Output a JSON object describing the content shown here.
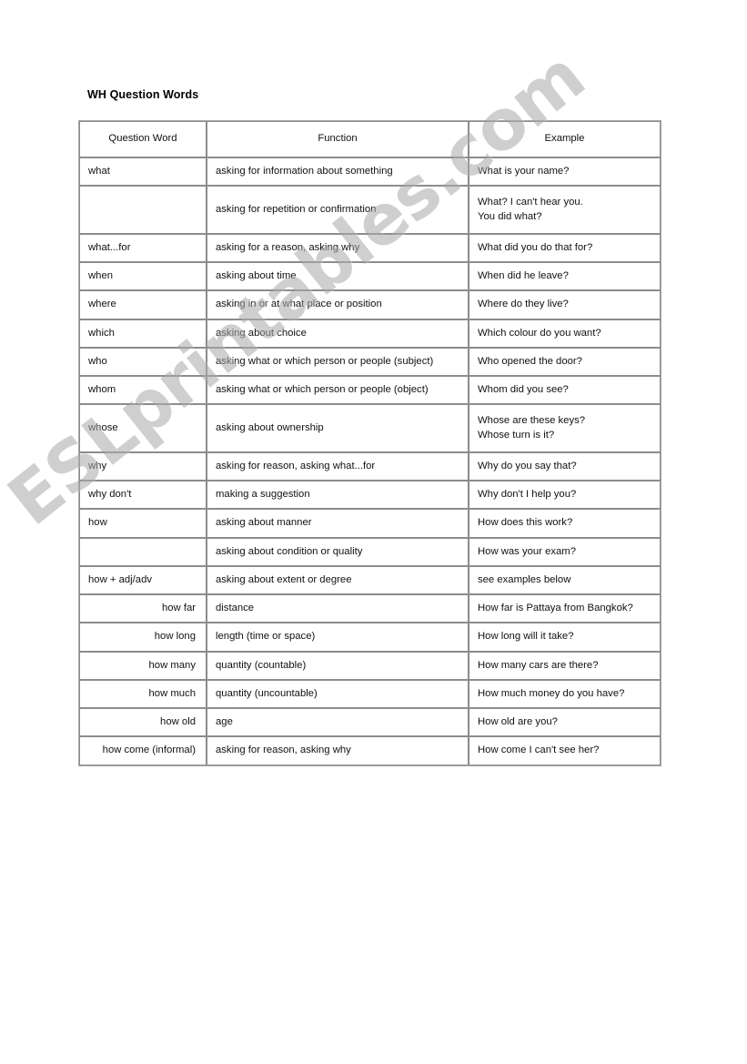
{
  "document": {
    "title": "WH Question Words",
    "watermark": "ESLprintables.com",
    "accent_blue": "#2b2b9e",
    "text_color": "#111111",
    "background": "#ffffff",
    "border_color": "#8c8c8c"
  },
  "table": {
    "headers": {
      "col1": "Question Word",
      "col2": "Function",
      "col3": "Example"
    },
    "rows": [
      {
        "word": "what",
        "indent": false,
        "function": "asking for information about something",
        "example": [
          "What is your name?"
        ]
      },
      {
        "word": "",
        "indent": false,
        "function": "asking for repetition or confirmation",
        "example": [
          "What? I can't hear you.",
          "You did what?"
        ]
      },
      {
        "word": "what...for",
        "indent": false,
        "function": "asking for a reason, asking why",
        "example": [
          "What did you do that for?"
        ]
      },
      {
        "word": "when",
        "indent": false,
        "function": "asking about time",
        "example": [
          "When did he leave?"
        ]
      },
      {
        "word": "where",
        "indent": false,
        "function": "asking in or at what place or position",
        "example": [
          "Where do they live?"
        ]
      },
      {
        "word": "which",
        "indent": false,
        "function": "asking about choice",
        "example": [
          "Which colour do you want?"
        ]
      },
      {
        "word": "who",
        "indent": false,
        "function": "asking what or which person or people (subject)",
        "example": [
          "Who opened the door?"
        ]
      },
      {
        "word": "whom",
        "indent": false,
        "function": "asking what or which person or people (object)",
        "example": [
          "Whom did you see?"
        ]
      },
      {
        "word": "whose",
        "indent": false,
        "function": "asking about ownership",
        "example": [
          "Whose are these keys?",
          "Whose turn is it?"
        ]
      },
      {
        "word": "why",
        "indent": false,
        "function": "asking for reason, asking what...for",
        "example": [
          "Why do you say that?"
        ]
      },
      {
        "word": "why don't",
        "indent": false,
        "function": "making a suggestion",
        "example": [
          "Why don't I help you?"
        ]
      },
      {
        "word": "how",
        "indent": false,
        "function": "asking about manner",
        "example": [
          "How does this work?"
        ]
      },
      {
        "word": "",
        "indent": false,
        "function": "asking about condition or quality",
        "example": [
          "How was your exam?"
        ]
      },
      {
        "word": "how + adj/adv",
        "indent": false,
        "function": "asking about extent or degree",
        "example": [
          "see examples below"
        ]
      },
      {
        "word": "how far",
        "indent": true,
        "function": "distance",
        "example": [
          "How far is Pattaya from Bangkok?"
        ]
      },
      {
        "word": "how long",
        "indent": true,
        "function": "length (time or space)",
        "example": [
          "How long will it take?"
        ]
      },
      {
        "word": "how many",
        "indent": true,
        "function": "quantity (countable)",
        "example": [
          "How many cars are there?"
        ]
      },
      {
        "word": "how much",
        "indent": true,
        "function": "quantity (uncountable)",
        "example": [
          "How much money do you have?"
        ]
      },
      {
        "word": "how old",
        "indent": true,
        "function": "age",
        "example": [
          "How old are you?"
        ]
      },
      {
        "word": "how come (informal)",
        "indent": true,
        "function": "asking for reason, asking why",
        "example": [
          "How come I can't see her?"
        ]
      }
    ]
  }
}
